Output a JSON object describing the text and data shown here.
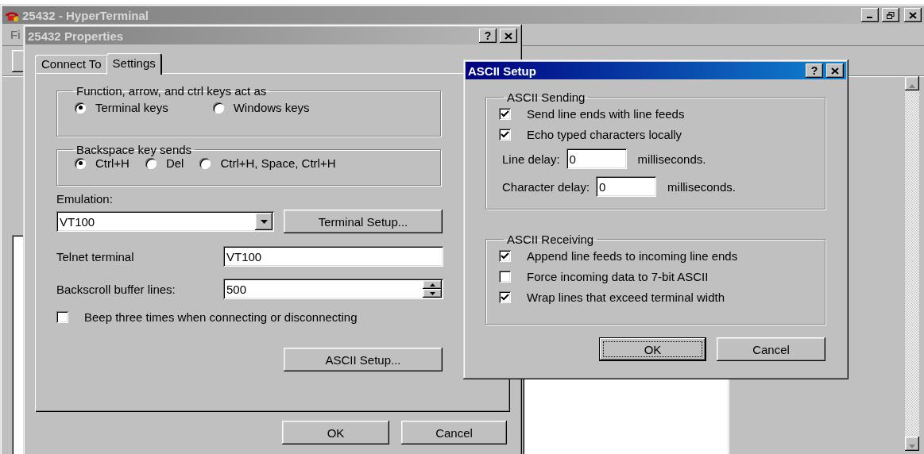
{
  "main_window": {
    "title": "25432 - HyperTerminal",
    "menu": [
      "Fi"
    ]
  },
  "properties_dialog": {
    "title": "25432 Properties",
    "help_button": "?",
    "tabs": [
      {
        "label": "Connect To",
        "selected": false
      },
      {
        "label": "Settings",
        "selected": true
      }
    ],
    "key_group": {
      "title": "Function, arrow, and ctrl keys act as",
      "options": [
        {
          "label": "Terminal keys",
          "selected": true
        },
        {
          "label": "Windows keys",
          "selected": false
        }
      ]
    },
    "backspace_group": {
      "title": "Backspace key sends",
      "options": [
        {
          "label": "Ctrl+H",
          "selected": true
        },
        {
          "label": "Del",
          "selected": false
        },
        {
          "label": "Ctrl+H, Space, Ctrl+H",
          "selected": false
        }
      ]
    },
    "emulation": {
      "label": "Emulation:",
      "value": "VT100"
    },
    "terminal_setup_button": "Terminal Setup...",
    "telnet_terminal": {
      "label": "Telnet terminal",
      "value": "VT100"
    },
    "backscroll": {
      "label": "Backscroll buffer lines:",
      "value": "500"
    },
    "beep": {
      "label": "Beep three times when connecting or disconnecting",
      "checked": false
    },
    "ascii_setup_button": "ASCII Setup...",
    "buttons": [
      {
        "label": "OK",
        "default": false
      },
      {
        "label": "Cancel",
        "default": false
      }
    ]
  },
  "ascii_setup_dialog": {
    "title": "ASCII Setup",
    "help_button": "?",
    "sending": {
      "title": "ASCII Sending",
      "options": [
        {
          "label": "Send line ends with line feeds",
          "checked": true
        },
        {
          "label": "Echo typed characters locally",
          "checked": true
        }
      ],
      "delays": [
        {
          "label": "Line delay:",
          "value": "0",
          "unit": "milliseconds."
        },
        {
          "label": "Character delay:",
          "value": "0",
          "unit": "milliseconds."
        }
      ]
    },
    "receiving": {
      "title": "ASCII Receiving",
      "options": [
        {
          "label": "Append line feeds to incoming line ends",
          "checked": true
        },
        {
          "label": "Force incoming data to 7-bit ASCII",
          "checked": false
        },
        {
          "label": "Wrap lines that exceed terminal width",
          "checked": true
        }
      ]
    },
    "buttons": [
      {
        "label": "OK",
        "default": true
      },
      {
        "label": "Cancel",
        "default": false
      }
    ]
  }
}
